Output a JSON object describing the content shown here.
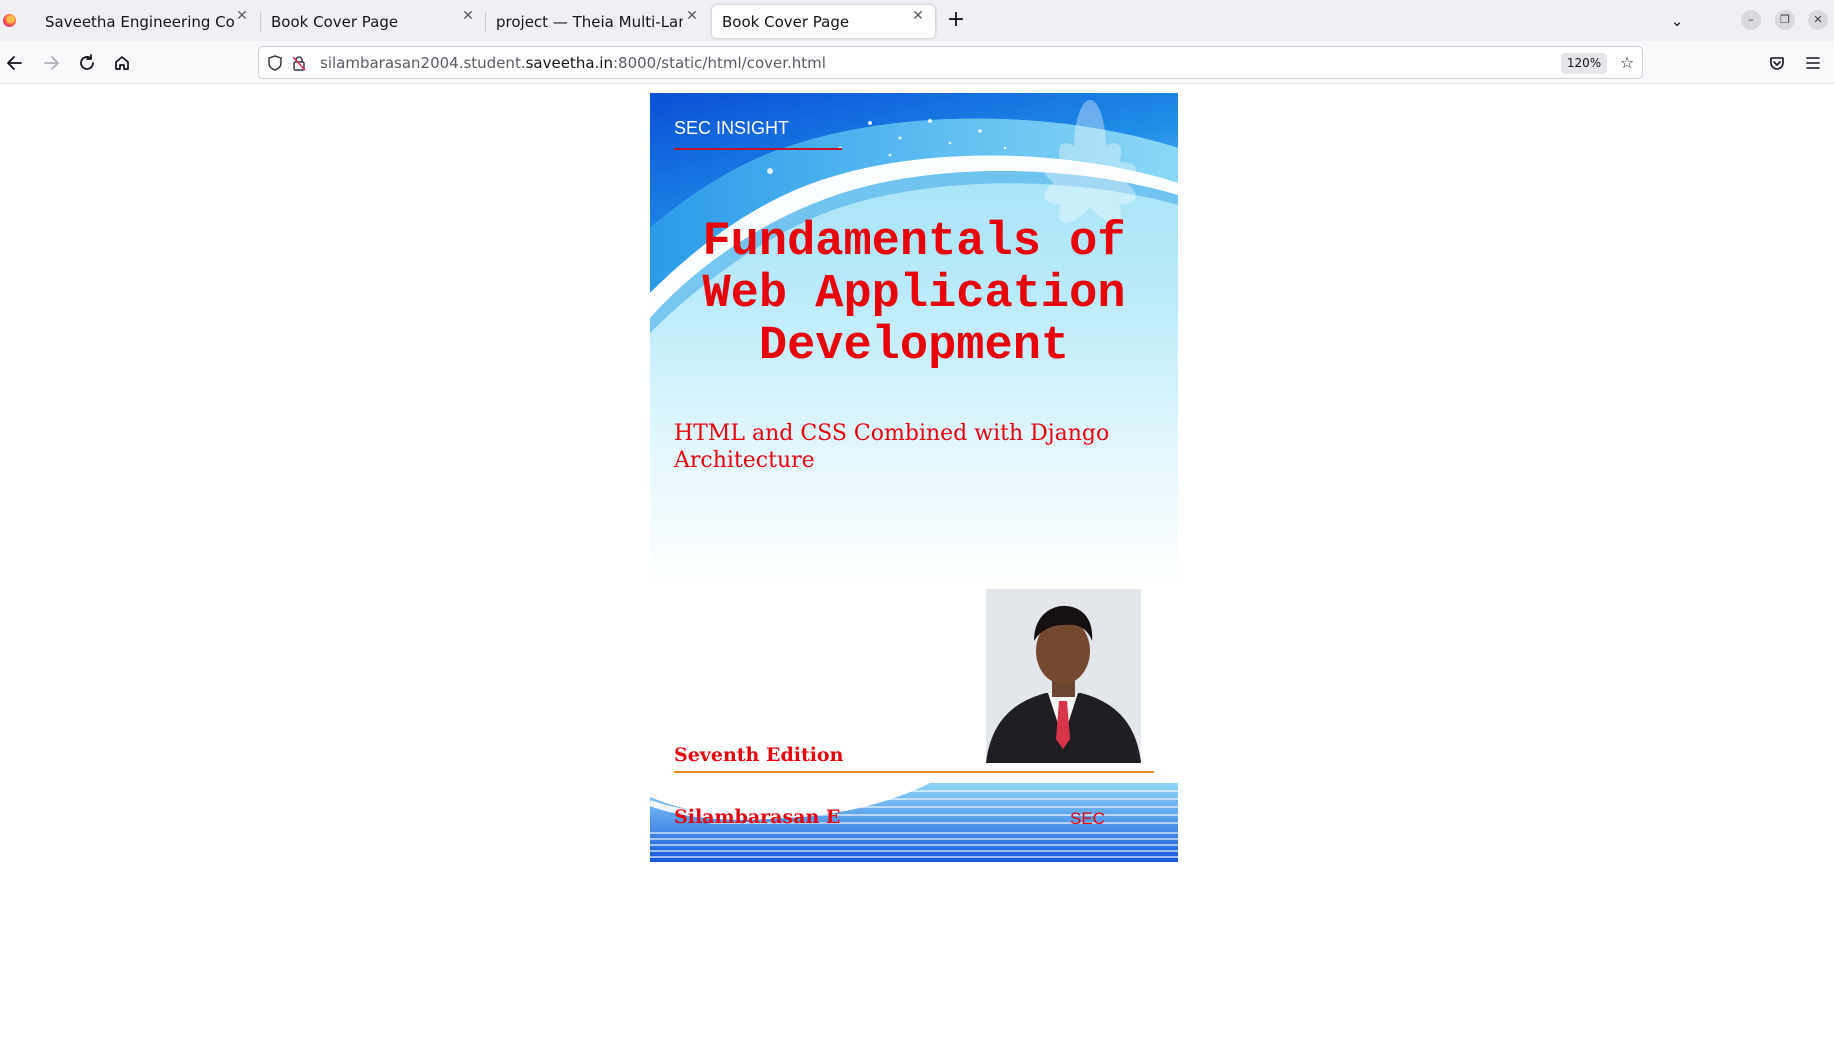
{
  "browser": {
    "tabs": [
      {
        "title": "Saveetha Engineering College",
        "active": false
      },
      {
        "title": "Book Cover Page",
        "active": false
      },
      {
        "title": "project — Theia Multi-Language",
        "active": false
      },
      {
        "title": "Book Cover Page",
        "active": true
      }
    ],
    "new_tab_symbol": "+",
    "url": {
      "prefix": "silambarasan2004.student.",
      "domain": "saveetha.in",
      "suffix": ":8000/static/html/cover.html"
    },
    "zoom": "120%",
    "icons": {
      "back": "back-arrow-icon",
      "forward": "forward-arrow-icon",
      "reload": "reload-icon",
      "home": "home-icon",
      "shield": "tracking-shield-icon",
      "lock": "insecure-lock-icon",
      "bookmark": "bookmark-star-icon",
      "pocket": "pocket-icon",
      "menu": "hamburger-menu-icon"
    }
  },
  "cover": {
    "brand": "SEC INSIGHT",
    "title_lines": [
      "Fundamentals of",
      "Web Application",
      "Development"
    ],
    "subtitle": "HTML and CSS Combined with Django Architecture",
    "edition": "Seventh Edition",
    "author": "Silambarasan E",
    "college": "SEC",
    "colors": {
      "title_red": "#e8000b",
      "sky_blue": "#9ddff5",
      "deep_blue": "#1565e0",
      "rule_orange": "#e88a1e"
    }
  }
}
